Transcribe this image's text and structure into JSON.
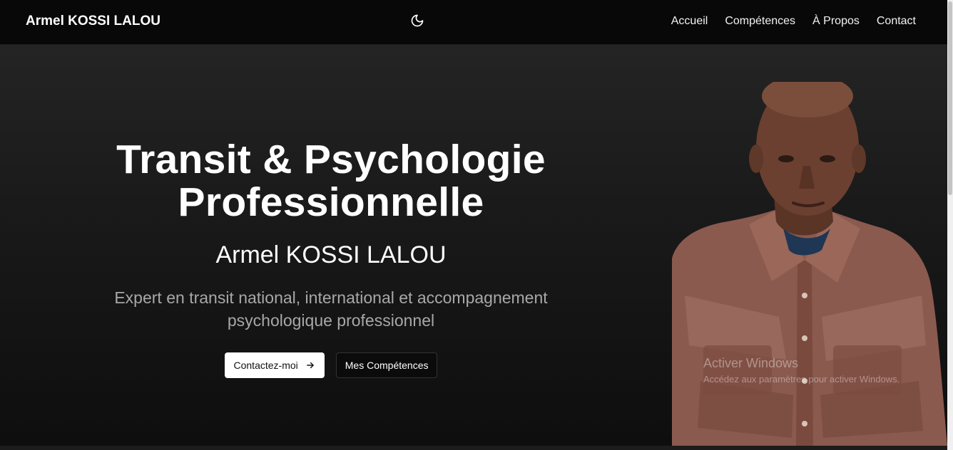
{
  "navbar": {
    "brand": "Armel KOSSI LALOU",
    "theme_icon": "moon-icon",
    "links": [
      "Accueil",
      "Compétences",
      "À Propos",
      "Contact"
    ]
  },
  "hero": {
    "title_line1": "Transit & Psychologie",
    "title_line2": "Professionnelle",
    "name": "Armel KOSSI LALOU",
    "description": "Expert en transit national, international et accompagnement psychologique professionnel",
    "primary_button": "Contactez-moi",
    "primary_button_icon": "arrow-right-icon",
    "secondary_button": "Mes Compétences",
    "photo": "portrait-photo"
  },
  "watermark": {
    "line1": "Activer Windows",
    "line2": "Accédez aux paramètres pour activer Windows."
  },
  "colors": {
    "background": "#0b0b0b",
    "hero_gradient_top": "#242424",
    "text": "#ffffff",
    "muted_text": "#a8a8a8",
    "shirt": "#8a5a4e"
  }
}
